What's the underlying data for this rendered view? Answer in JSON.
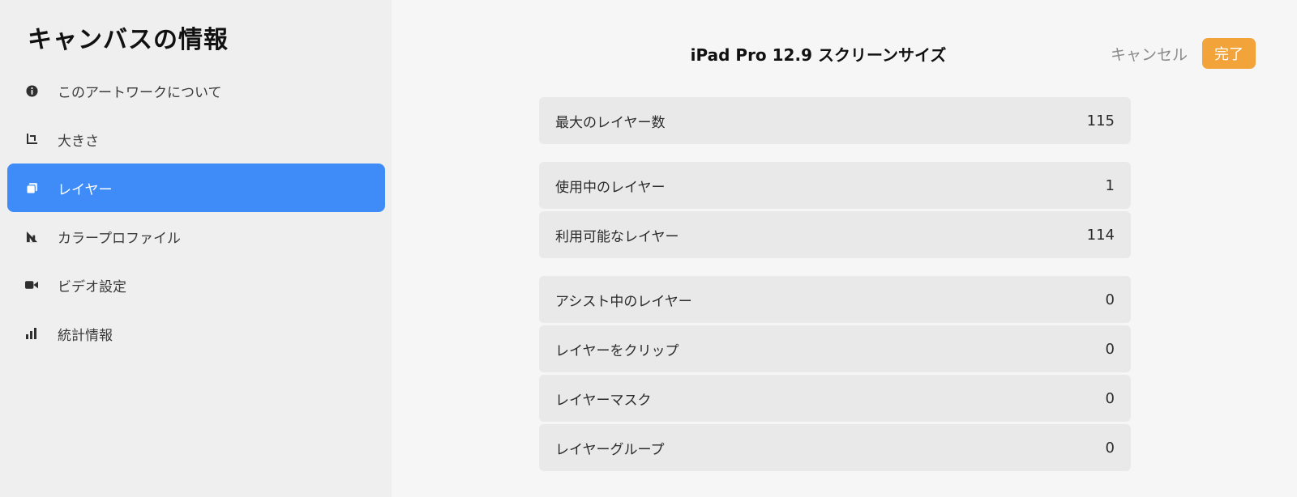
{
  "sidebar": {
    "title": "キャンバスの情報",
    "items": [
      {
        "label": "このアートワークについて",
        "icon": "info-icon"
      },
      {
        "label": "大きさ",
        "icon": "crop-icon"
      },
      {
        "label": "レイヤー",
        "icon": "layers-icon",
        "active": true
      },
      {
        "label": "カラープロファイル",
        "icon": "color-profile-icon"
      },
      {
        "label": "ビデオ設定",
        "icon": "video-camera-icon"
      },
      {
        "label": "統計情報",
        "icon": "bar-chart-icon"
      }
    ]
  },
  "header": {
    "title": "iPad Pro 12.9 スクリーンサイズ",
    "cancel_label": "キャンセル",
    "done_label": "完了"
  },
  "stats": {
    "max_layers": {
      "label": "最大のレイヤー数",
      "value": "115"
    },
    "used_layers": {
      "label": "使用中のレイヤー",
      "value": "1"
    },
    "available_layers": {
      "label": "利用可能なレイヤー",
      "value": "114"
    },
    "assist_layers": {
      "label": "アシスト中のレイヤー",
      "value": "0"
    },
    "clip_layers": {
      "label": "レイヤーをクリップ",
      "value": "0"
    },
    "layer_masks": {
      "label": "レイヤーマスク",
      "value": "0"
    },
    "layer_groups": {
      "label": "レイヤーグループ",
      "value": "0"
    }
  },
  "colors": {
    "accent_blue": "#3f8cf9",
    "done_orange": "#f2a33a"
  }
}
